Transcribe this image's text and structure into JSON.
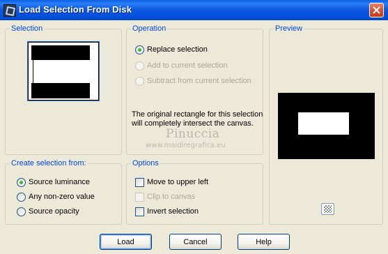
{
  "window": {
    "title": "Load Selection From Disk",
    "close_icon": "close-x-icon",
    "app_icon": "psp-icon"
  },
  "selection_group": {
    "label": "Selection"
  },
  "operation_group": {
    "label": "Operation",
    "options": [
      {
        "label": "Replace selection",
        "selected": true,
        "enabled": true
      },
      {
        "label": "Add to current selection",
        "selected": false,
        "enabled": false
      },
      {
        "label": "Subtract from current selection",
        "selected": false,
        "enabled": false
      }
    ],
    "info_line1": "The original rectangle for this selection",
    "info_line2": "will completely intersect the canvas."
  },
  "watermark": {
    "name": "Pinuccia",
    "url": "www.maidiregrafica.eu"
  },
  "preview_group": {
    "label": "Preview",
    "background_color": "#000000",
    "rect_color": "#ffffff"
  },
  "create_group": {
    "label": "Create selection from:",
    "options": [
      {
        "label": "Source luminance",
        "selected": true
      },
      {
        "label": "Any non-zero value",
        "selected": false
      },
      {
        "label": "Source opacity",
        "selected": false
      }
    ]
  },
  "options_group": {
    "label": "Options",
    "checks": [
      {
        "label": "Move to upper left",
        "checked": false,
        "enabled": true
      },
      {
        "label": "Clip to canvas",
        "checked": false,
        "enabled": false
      },
      {
        "label": "Invert selection",
        "checked": false,
        "enabled": true
      }
    ]
  },
  "buttons": {
    "load": "Load",
    "cancel": "Cancel",
    "help": "Help"
  }
}
